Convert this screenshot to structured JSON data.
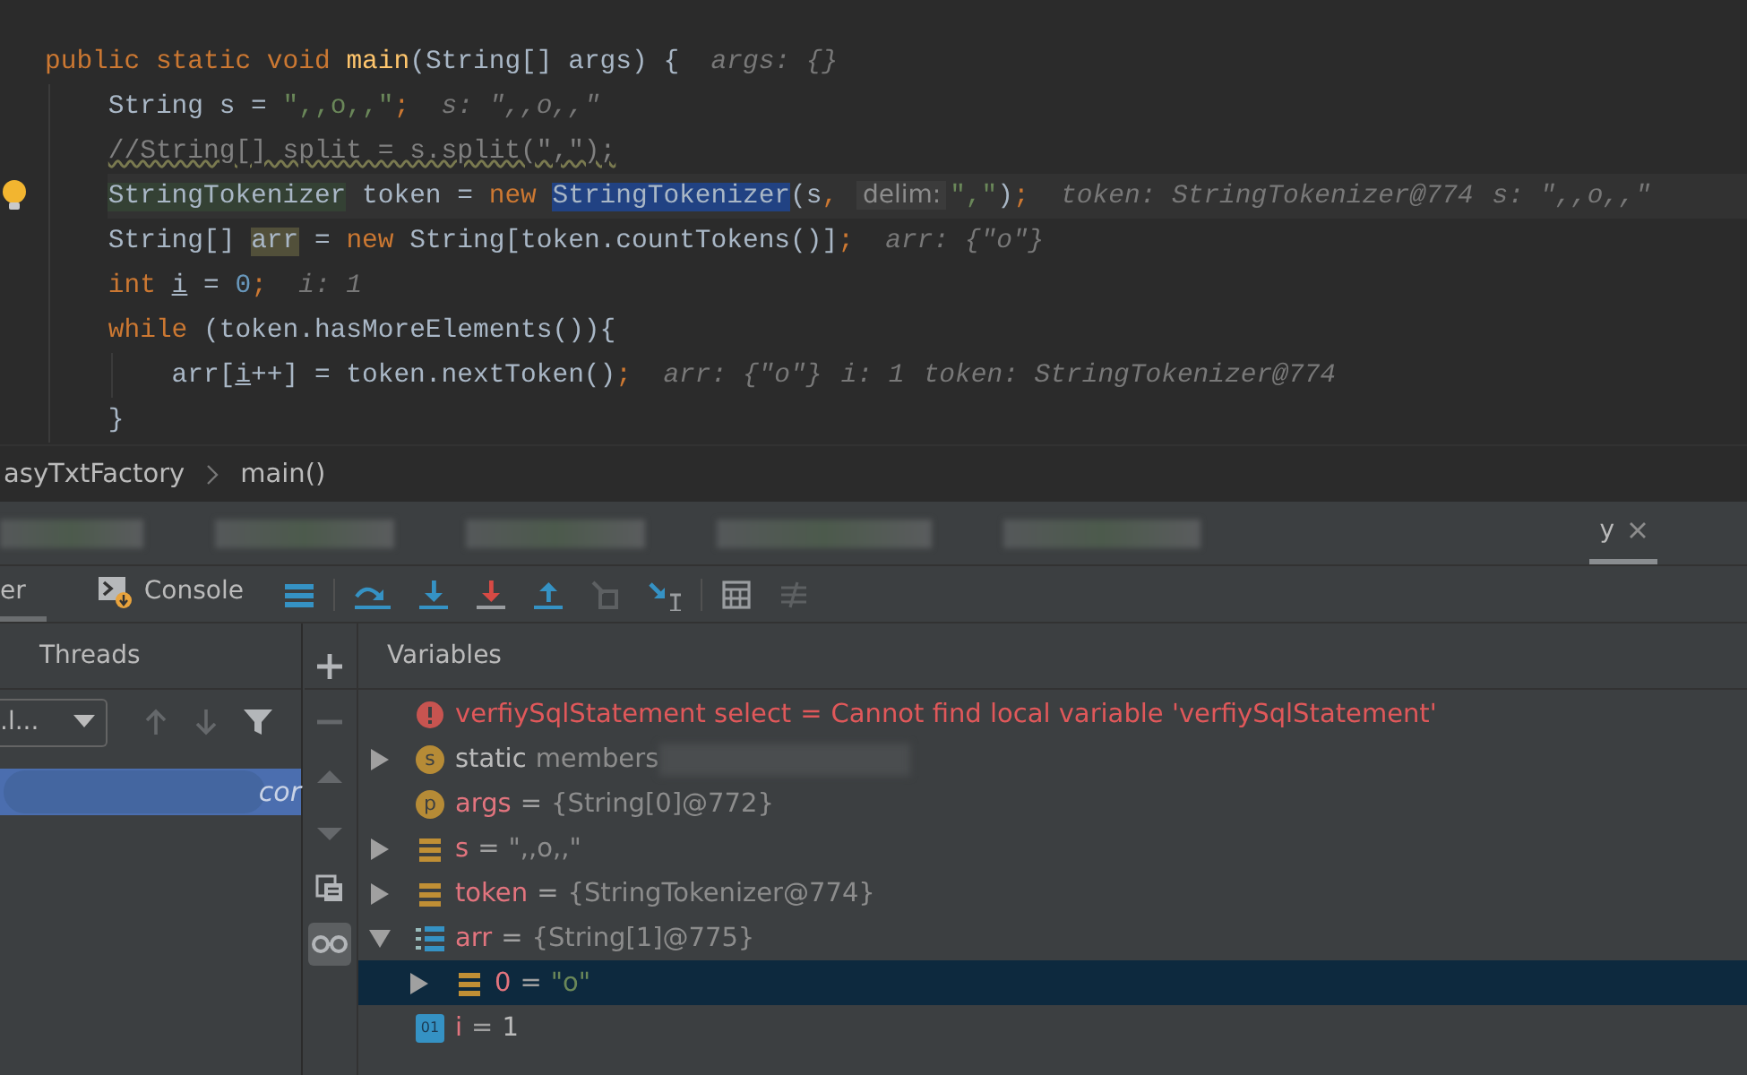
{
  "editor": {
    "lines": [
      {
        "bulb": false,
        "current": false,
        "segments": [
          {
            "kind": "kw",
            "text": "public static void "
          },
          {
            "kind": "fn",
            "text": "main"
          },
          {
            "kind": "plain",
            "text": "(String[] args) {"
          }
        ],
        "hints": [
          "args: {}"
        ],
        "children": [
          {
            "bulb": false,
            "current": false,
            "segments": [
              {
                "kind": "plain",
                "text": "String s = "
              },
              {
                "kind": "str",
                "text": "\",,o,,\""
              },
              {
                "kind": "kw",
                "text": ";"
              }
            ],
            "hints": [
              "s: \",,o,,\""
            ]
          },
          {
            "bulb": false,
            "current": false,
            "segments": [
              {
                "kind": "comment",
                "text": "//String[] split = s.split(\",\");"
              }
            ]
          },
          {
            "bulb": true,
            "current": true,
            "segments": [
              {
                "kind": "usage",
                "text": "StringTokenizer"
              },
              {
                "kind": "plain",
                "text": " token = "
              },
              {
                "kind": "kw",
                "text": "new "
              },
              {
                "kind": "sel",
                "text": "StringTokenizer"
              },
              {
                "kind": "plain",
                "text": "(s"
              },
              {
                "kind": "kw",
                "text": ", "
              },
              {
                "kind": "param",
                "text": "delim:"
              },
              {
                "kind": "str",
                "text": "\",\""
              },
              {
                "kind": "plain",
                "text": ")"
              },
              {
                "kind": "kw",
                "text": ";"
              }
            ],
            "hints": [
              "token: StringTokenizer@774",
              "s: \",,o,,\""
            ]
          },
          {
            "bulb": false,
            "current": false,
            "segments": [
              {
                "kind": "plain",
                "text": "String[] "
              },
              {
                "kind": "write",
                "text": "arr"
              },
              {
                "kind": "plain",
                "text": " = "
              },
              {
                "kind": "kw",
                "text": "new "
              },
              {
                "kind": "plain",
                "text": "String[token.countTokens()]"
              },
              {
                "kind": "kw",
                "text": ";"
              }
            ],
            "hints": [
              "arr: {\"o\"}"
            ]
          },
          {
            "bulb": false,
            "current": false,
            "segments": [
              {
                "kind": "kw",
                "text": "int "
              },
              {
                "kind": "underlined",
                "text": "i"
              },
              {
                "kind": "plain",
                "text": " = "
              },
              {
                "kind": "num",
                "text": "0"
              },
              {
                "kind": "kw",
                "text": ";"
              }
            ],
            "hints": [
              "i: 1"
            ]
          },
          {
            "bulb": false,
            "current": false,
            "segments": [
              {
                "kind": "kw",
                "text": "while "
              },
              {
                "kind": "plain",
                "text": "(token.hasMoreElements()){"
              }
            ],
            "children": [
              {
                "bulb": false,
                "current": false,
                "segments": [
                  {
                    "kind": "plain",
                    "text": "arr["
                  },
                  {
                    "kind": "underlined",
                    "text": "i"
                  },
                  {
                    "kind": "plain",
                    "text": "++] = token.nextToken()"
                  },
                  {
                    "kind": "kw",
                    "text": ";"
                  }
                ],
                "hints": [
                  "arr: {\"o\"}",
                  "i: 1",
                  "token: StringTokenizer@774"
                ]
              }
            ]
          },
          {
            "bulb": false,
            "current": false,
            "segments": [
              {
                "kind": "plain",
                "text": "}"
              }
            ]
          }
        ]
      }
    ]
  },
  "breadcrumb": [
    "asyTxtFactory",
    "main()"
  ],
  "tool_tabs": [
    {
      "kind": "blurred",
      "selected": false
    },
    {
      "kind": "blurred",
      "selected": false
    },
    {
      "kind": "blurred",
      "selected": false
    },
    {
      "kind": "blurred",
      "selected": false
    },
    {
      "kind": "blurred",
      "selected": false
    },
    {
      "kind": "tab",
      "label": "y",
      "selected": true
    }
  ],
  "debug_tabs": [
    {
      "kind": "plain",
      "label": "er",
      "selected": true
    },
    {
      "kind": "console",
      "label": "Console",
      "selected": false
    }
  ],
  "debug_toolbar": [
    [
      {
        "kind": "layout",
        "disabled": false
      }
    ],
    [
      {
        "kind": "step-over",
        "disabled": false
      },
      {
        "kind": "step-into",
        "disabled": false
      },
      {
        "kind": "force-step-into",
        "disabled": false
      },
      {
        "kind": "step-out",
        "disabled": false
      },
      {
        "kind": "drop-frame",
        "disabled": true
      },
      {
        "kind": "run-to-cursor",
        "disabled": false
      }
    ],
    [
      {
        "kind": "evaluate",
        "disabled": false
      },
      {
        "kind": "trace",
        "disabled": true
      }
    ]
  ],
  "frames": {
    "header": "Threads",
    "dropdown": ".l...",
    "buttons": [
      {
        "kind": "up",
        "disabled": true
      },
      {
        "kind": "down",
        "disabled": true
      },
      {
        "kind": "filter",
        "disabled": false
      }
    ],
    "rows": [
      {
        "text": "cor",
        "selected": true
      }
    ]
  },
  "side_toolbar": [
    {
      "kind": "add",
      "disabled": false,
      "selected": false
    },
    {
      "kind": "remove",
      "disabled": true,
      "selected": false
    },
    {
      "kind": "up",
      "disabled": true,
      "selected": false
    },
    {
      "kind": "down",
      "disabled": true,
      "selected": false
    },
    {
      "kind": "copy",
      "disabled": false,
      "selected": false
    },
    {
      "kind": "watch",
      "disabled": false,
      "selected": true
    }
  ],
  "variables": {
    "header": "Variables",
    "items": [
      {
        "kind": "error",
        "name": "verfiySqlStatement select",
        "operator": "=",
        "value": "Cannot find local variable 'verfiySqlStatement'",
        "expandable": false,
        "selected": false
      },
      {
        "kind": "static",
        "badge": "s",
        "name": "static",
        "value": "members",
        "expandable": true,
        "expanded": false,
        "selected": false
      },
      {
        "kind": "param",
        "badge": "p",
        "name": "args",
        "operator": "=",
        "value": "{String[0]@772}",
        "expandable": false,
        "selected": false
      },
      {
        "kind": "field",
        "name": "s",
        "operator": "=",
        "value": "\",,o,,\"",
        "expandable": true,
        "expanded": false,
        "selected": false
      },
      {
        "kind": "field",
        "name": "token",
        "operator": "=",
        "value": "{StringTokenizer@774}",
        "expandable": true,
        "expanded": false,
        "selected": false
      },
      {
        "kind": "array",
        "name": "arr",
        "operator": "=",
        "value": "{String[1]@775}",
        "expandable": true,
        "expanded": true,
        "selected": false,
        "children": [
          {
            "kind": "element",
            "name": "0",
            "operator": "=",
            "value": "\"o\"",
            "expandable": true,
            "expanded": false,
            "selected": true
          }
        ]
      },
      {
        "kind": "primitive",
        "badge": "01",
        "name": "i",
        "operator": "=",
        "value": "1",
        "expandable": false,
        "selected": false
      }
    ]
  }
}
